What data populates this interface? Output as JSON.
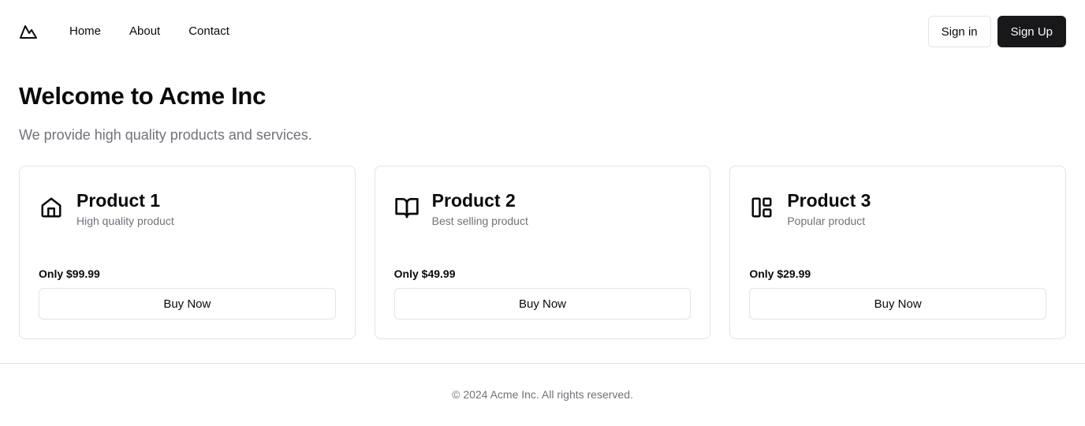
{
  "nav": {
    "logo_icon": "mountain-icon",
    "links": [
      "Home",
      "About",
      "Contact"
    ],
    "sign_in": "Sign in",
    "sign_up": "Sign Up"
  },
  "hero": {
    "title": "Welcome to Acme Inc",
    "subtitle": "We provide high quality products and services."
  },
  "products": [
    {
      "icon": "home-icon",
      "title": "Product 1",
      "subtitle": "High quality product",
      "price": "Only $99.99",
      "button": "Buy Now"
    },
    {
      "icon": "book-open-icon",
      "title": "Product 2",
      "subtitle": "Best selling product",
      "price": "Only $49.99",
      "button": "Buy Now"
    },
    {
      "icon": "layout-icon",
      "title": "Product 3",
      "subtitle": "Popular product",
      "price": "Only $29.99",
      "button": "Buy Now"
    }
  ],
  "footer": {
    "text": "© 2024 Acme Inc. All rights reserved."
  },
  "colors": {
    "primary_button": "#18181b",
    "border": "#e4e4e7",
    "muted_text": "#71717a"
  }
}
